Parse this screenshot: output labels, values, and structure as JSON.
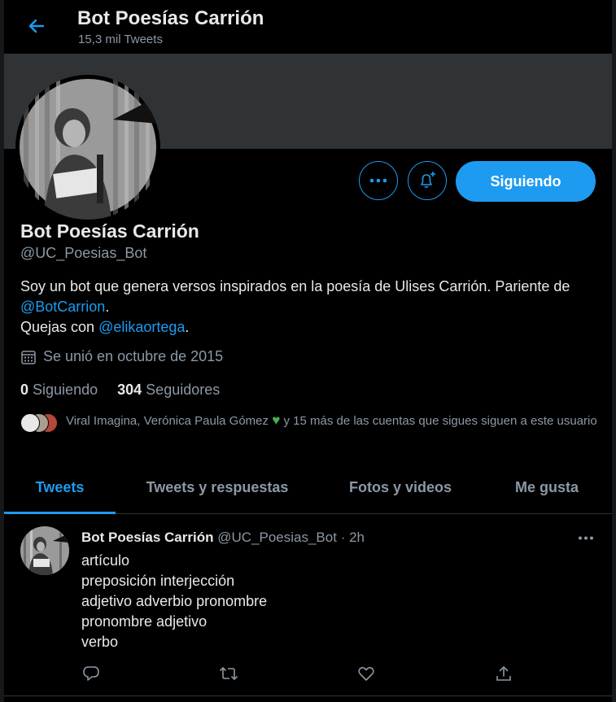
{
  "header": {
    "title": "Bot Poesías Carrión",
    "tweet_count": "15,3 mil Tweets"
  },
  "profile": {
    "name": "Bot Poesías Carrión",
    "handle": "@UC_Poesias_Bot",
    "bio_text_1": "Soy un bot que genera versos inspirados en la poesía de Ulises Carrión. Pariente de",
    "bio_link_1": "@BotCarrion",
    "bio_text_2": ".",
    "bio_text_3": "Quejas con",
    "bio_link_2": "@elikaortega",
    "bio_text_4": ".",
    "joined": "Se unió en octubre de 2015",
    "following_count": "0",
    "following_label": "Siguiendo",
    "followers_count": "304",
    "followers_label": "Seguidores",
    "known_followers_text": "Viral Imagina, Verónica Paula Gómez",
    "known_followers_suffix": "y 15 más de las cuentas que sigues siguen a este usuario"
  },
  "actions": {
    "follow_label": "Siguiendo"
  },
  "tabs": [
    {
      "label": "Tweets",
      "active": true
    },
    {
      "label": "Tweets y respuestas",
      "active": false
    },
    {
      "label": "Fotos y videos",
      "active": false
    },
    {
      "label": "Me gusta",
      "active": false
    }
  ],
  "tweet": {
    "name": "Bot Poesías Carrión",
    "handle": "@UC_Poesias_Bot",
    "separator": "·",
    "time": "2h",
    "lines": [
      "artículo",
      "preposición interjección",
      "adjetivo adverbio pronombre",
      "pronombre adjetivo",
      "verbo"
    ]
  },
  "colors": {
    "accent": "#1d9bf0",
    "background": "#000000",
    "banner": "#2f3336",
    "secondary_text": "#8b98a5"
  },
  "icons": [
    "back-arrow-icon",
    "more-icon",
    "bell-plus-icon",
    "calendar-icon",
    "heart-emoji-icon",
    "reply-icon",
    "retweet-icon",
    "like-icon",
    "share-icon"
  ]
}
